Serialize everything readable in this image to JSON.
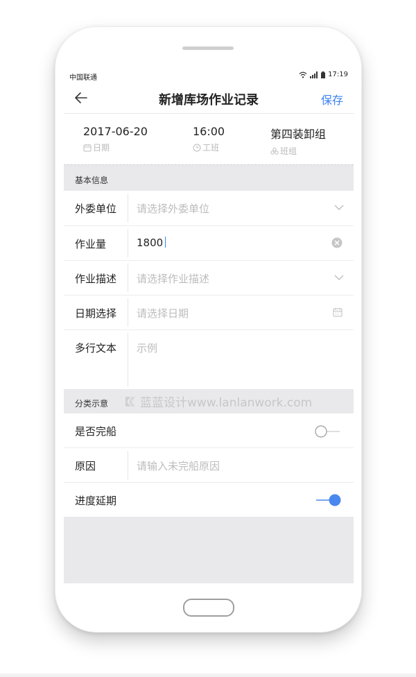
{
  "status_bar": {
    "carrier": "中国联通",
    "time": "17:19"
  },
  "nav": {
    "title": "新增库场作业记录",
    "save_label": "保存"
  },
  "summary": [
    {
      "value": "2017-06-20",
      "label": "日期",
      "icon": "calendar-icon"
    },
    {
      "value": "16:00",
      "label": "工班",
      "icon": "clock-icon"
    },
    {
      "value": "第四装卸组",
      "label": "班组",
      "icon": "group-icon"
    }
  ],
  "sections": {
    "basic": {
      "title": "基本信息"
    },
    "category": {
      "title": "分类示意"
    }
  },
  "watermark": {
    "text": "蓝蓝设计www.lanlanwork.com"
  },
  "form": {
    "outsource": {
      "label": "外委单位",
      "placeholder": "请选择外委单位",
      "icon": "chevron-down-icon"
    },
    "workload": {
      "label": "作业量",
      "value": "1800",
      "icon": "clear-icon"
    },
    "description": {
      "label": "作业描述",
      "placeholder": "请选择作业描述",
      "icon": "chevron-down-icon"
    },
    "date": {
      "label": "日期选择",
      "placeholder": "请选择日期",
      "icon": "calendar-icon"
    },
    "multiline": {
      "label": "多行文本",
      "placeholder": "示例"
    },
    "ship_done": {
      "label": "是否完船",
      "on": false
    },
    "reason": {
      "label": "原因",
      "placeholder": "请输入未完船原因"
    },
    "delay": {
      "label": "进度延期",
      "on": true
    }
  },
  "colors": {
    "accent": "#3a82f1",
    "toggle_on": "#4a87ef",
    "background": "#e9e9ec"
  }
}
